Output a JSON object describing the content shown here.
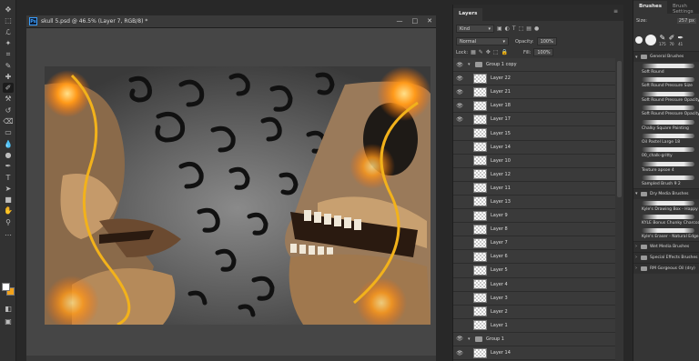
{
  "document": {
    "title": "skull 5.psd @ 46.5% (Layer 7, RGB/8) *",
    "icon_text": "Ps",
    "window_buttons": [
      "—",
      "□",
      "✕"
    ]
  },
  "toolbar": {
    "tools": [
      "move-tool",
      "marquee-tool",
      "lasso-tool",
      "magic-wand-tool",
      "crop-tool",
      "eyedropper-tool",
      "healing-brush-tool",
      "brush-tool",
      "clone-stamp-tool",
      "history-brush-tool",
      "eraser-tool",
      "gradient-tool",
      "blur-tool",
      "dodge-tool",
      "pen-tool",
      "type-tool",
      "path-selection-tool",
      "shape-tool",
      "hand-tool",
      "zoom-tool",
      "more-tools"
    ],
    "tool_glyphs": [
      "✥",
      "⬚",
      "ℒ",
      "✦",
      "⌗",
      "✎",
      "✚",
      "✐",
      "⚒",
      "↺",
      "⌫",
      "▭",
      "💧",
      "●",
      "✒",
      "T",
      "➤",
      "■",
      "✋",
      "⚲",
      "…"
    ],
    "active_tool": 7,
    "foreground_color": "#ffffff",
    "background_color": "#f2a21b",
    "extra_icons": [
      "◧",
      "▣"
    ]
  },
  "layers_panel": {
    "tabs": [
      "Layers"
    ],
    "filter_label": "Kind",
    "filter_icons": [
      "▣",
      "◐",
      "T",
      "⬚",
      "▤",
      "●"
    ],
    "blend_mode": "Normal",
    "opacity_label": "Opacity:",
    "opacity_value": "100%",
    "lock_label": "Lock:",
    "lock_icons": [
      "▦",
      "✎",
      "✥",
      "⬚",
      "🔒"
    ],
    "fill_label": "Fill:",
    "fill_value": "100%",
    "layers": [
      {
        "name": "Group 1 copy",
        "group": true,
        "visible": true
      },
      {
        "name": "Layer 22",
        "visible": true
      },
      {
        "name": "Layer 21",
        "visible": true
      },
      {
        "name": "Layer 18",
        "visible": true
      },
      {
        "name": "Layer 17",
        "visible": true
      },
      {
        "name": "Layer 15",
        "visible": false
      },
      {
        "name": "Layer 14",
        "visible": false
      },
      {
        "name": "Layer 10",
        "visible": false
      },
      {
        "name": "Layer 12",
        "visible": false
      },
      {
        "name": "Layer 11",
        "visible": false
      },
      {
        "name": "Layer 13",
        "visible": false
      },
      {
        "name": "Layer 9",
        "visible": false
      },
      {
        "name": "Layer 8",
        "visible": false
      },
      {
        "name": "Layer 7",
        "visible": false
      },
      {
        "name": "Layer 6",
        "visible": false
      },
      {
        "name": "Layer 5",
        "visible": false
      },
      {
        "name": "Layer 4",
        "visible": false
      },
      {
        "name": "Layer 3",
        "visible": false
      },
      {
        "name": "Layer 2",
        "visible": false
      },
      {
        "name": "Layer 1",
        "visible": false
      },
      {
        "name": "Group 1",
        "group": true,
        "visible": true
      },
      {
        "name": "Layer 14",
        "visible": true
      }
    ]
  },
  "brushes_panel": {
    "tabs": [
      "Brushes",
      "Brush Settings"
    ],
    "size_label": "Size:",
    "size_value": "257 px",
    "recent_sizes": [
      "175",
      "70",
      "41"
    ],
    "items": [
      {
        "type": "group",
        "name": "General Brushes"
      },
      {
        "type": "brush",
        "name": "Soft Round"
      },
      {
        "type": "brush",
        "name": "Soft Round Pressure Size"
      },
      {
        "type": "brush",
        "name": "Soft Round Pressure Opacity"
      },
      {
        "type": "brush",
        "name": "Soft Round Pressure Opacity"
      },
      {
        "type": "brush",
        "name": "Chalky Square Painting"
      },
      {
        "type": "brush",
        "name": "Oil Pastel Large 18"
      },
      {
        "type": "brush",
        "name": "00_chalk-gritty"
      },
      {
        "type": "brush",
        "name": "Texture apsoe 4"
      },
      {
        "type": "brush",
        "name": "Sampled Brush 9 2"
      },
      {
        "type": "group",
        "name": "Dry Media Brushes"
      },
      {
        "type": "brush",
        "name": "Kyle's Drawing Box - Happy"
      },
      {
        "type": "brush",
        "name": "KYLE Bonus Chunky Charcoal"
      },
      {
        "type": "brush",
        "name": "Kyle's Eraser - Natural Edge"
      },
      {
        "type": "group",
        "name": "Wet Media Brushes"
      },
      {
        "type": "group",
        "name": "Special Effects Brushes"
      },
      {
        "type": "group",
        "name": "RM Gorgeous Oil (dry)"
      }
    ]
  }
}
